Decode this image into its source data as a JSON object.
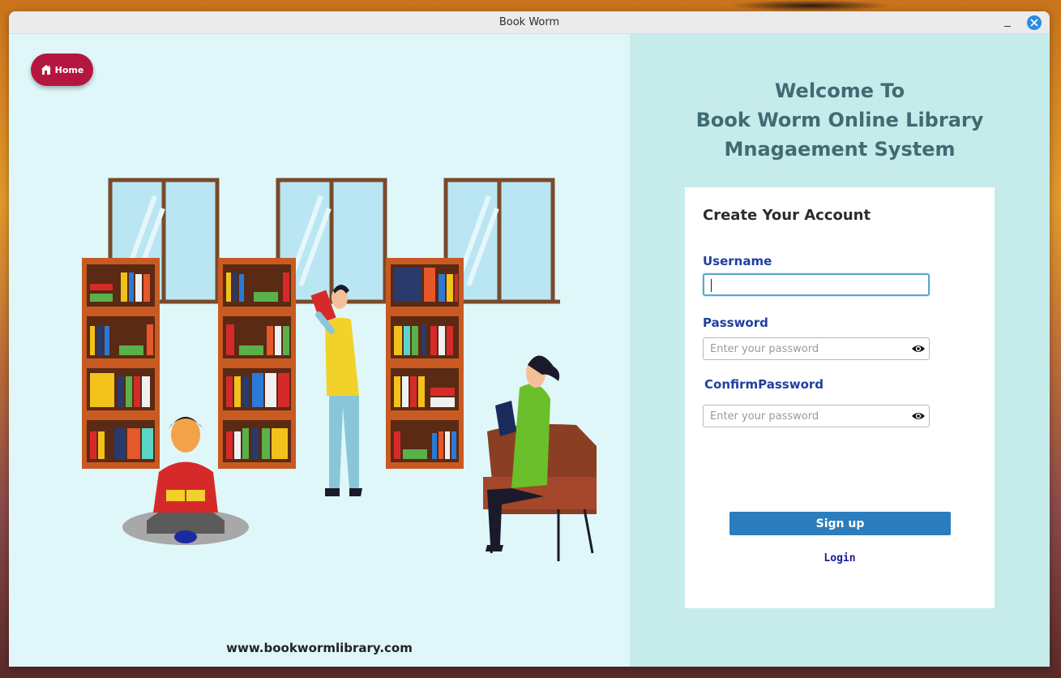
{
  "window": {
    "title": "Book Worm"
  },
  "left": {
    "home_label": "Home",
    "site_url": "www.bookwormlibrary.com"
  },
  "right": {
    "welcome_line1": "Welcome To",
    "welcome_line2": "Book Worm Online Library",
    "welcome_line3": "Mnagaement System",
    "card_title": "Create Your Account",
    "username_label": "Username",
    "username_value": "",
    "password_label": "Password",
    "password_placeholder": "Enter your password",
    "confirm_label": "ConfirmPassword",
    "confirm_placeholder": "Enter your password",
    "signup_label": "Sign up",
    "login_label": "Login"
  },
  "colors": {
    "home_button": "#b5163f",
    "left_bg": "#dff7f9",
    "right_bg": "#c6ebeb",
    "welcome_text": "#3f6b73",
    "field_label": "#1f3fa0",
    "signup_button": "#2b7dbd",
    "login_link": "#1a1aa0"
  }
}
